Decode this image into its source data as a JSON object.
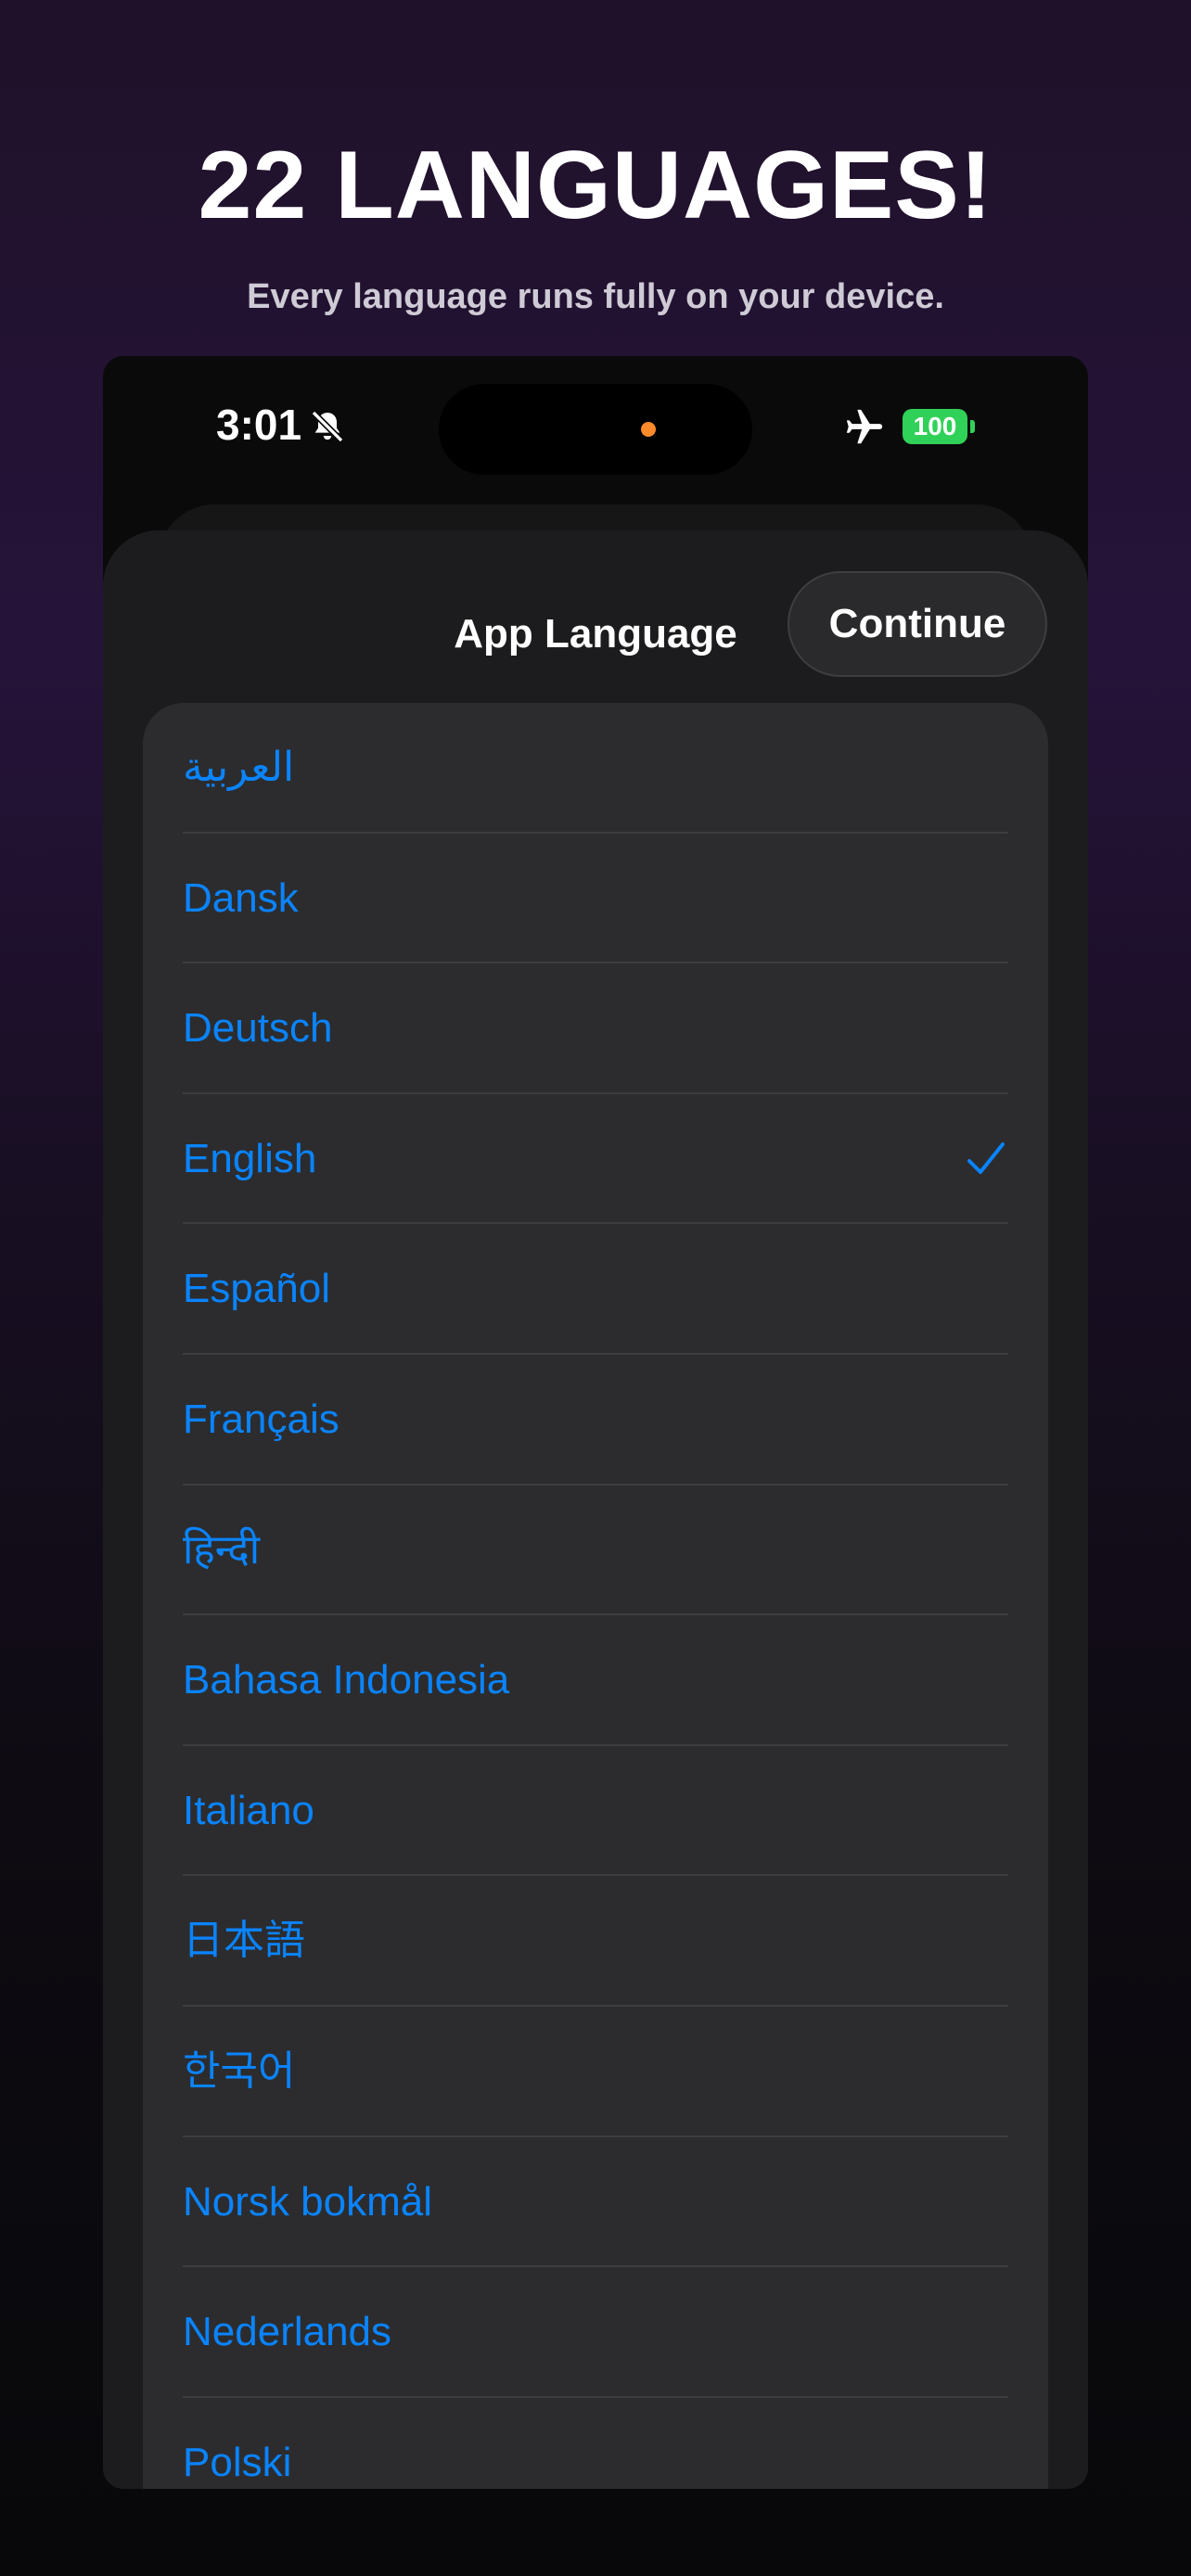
{
  "promo": {
    "title": "22 LANGUAGES!",
    "subtitle": "Every language runs fully on your device."
  },
  "status_bar": {
    "time": "3:01",
    "battery": "100",
    "icons": [
      "bell-slash-icon",
      "airplane-icon",
      "battery-icon"
    ]
  },
  "sheet": {
    "title": "App Language",
    "continue_label": "Continue"
  },
  "languages": [
    {
      "label": "العربية",
      "selected": false
    },
    {
      "label": "Dansk",
      "selected": false
    },
    {
      "label": "Deutsch",
      "selected": false
    },
    {
      "label": "English",
      "selected": true
    },
    {
      "label": "Español",
      "selected": false
    },
    {
      "label": "Français",
      "selected": false
    },
    {
      "label": "हिन्दी",
      "selected": false
    },
    {
      "label": "Bahasa Indonesia",
      "selected": false
    },
    {
      "label": "Italiano",
      "selected": false
    },
    {
      "label": "日本語",
      "selected": false
    },
    {
      "label": "한국어",
      "selected": false
    },
    {
      "label": "Norsk bokmål",
      "selected": false
    },
    {
      "label": "Nederlands",
      "selected": false
    },
    {
      "label": "Polski",
      "selected": false
    }
  ],
  "colors": {
    "accent": "#0a84ff",
    "battery": "#30d158",
    "sheet": "#1c1c1e",
    "list": "#2c2c2e"
  }
}
